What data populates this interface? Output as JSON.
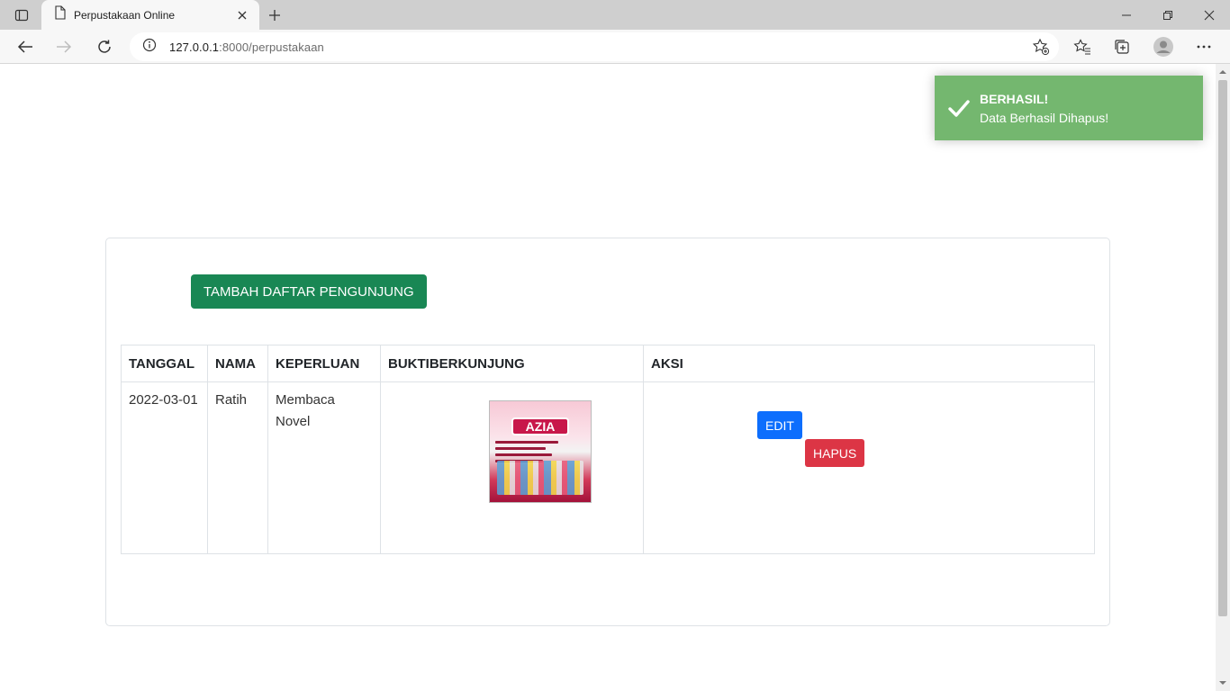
{
  "browser": {
    "tab_title": "Perpustakaan Online",
    "url_host": "127.0.0.1",
    "url_path": ":8000/perpustakaan"
  },
  "page": {
    "add_button_label": "TAMBAH DAFTAR PENGUNJUNG",
    "table": {
      "headers": [
        "TANGGAL",
        "NAMA",
        "KEPERLUAN",
        "BUKTIBERKUNJUNG",
        "AKSI"
      ],
      "rows": [
        {
          "tanggal": "2022-03-01",
          "nama": "Ratih",
          "keperluan": "Membaca Novel",
          "bukti_image_text": "TOKO SUSU AZIA",
          "edit_label": "EDIT",
          "delete_label": "HAPUS"
        }
      ]
    }
  },
  "toast": {
    "title": "BERHASIL!",
    "message": "Data Berhasil Dihapus!",
    "color": "#74b76f"
  },
  "colors": {
    "success_button": "#198754",
    "primary_button": "#0d6efd",
    "danger_button": "#dc3545"
  }
}
